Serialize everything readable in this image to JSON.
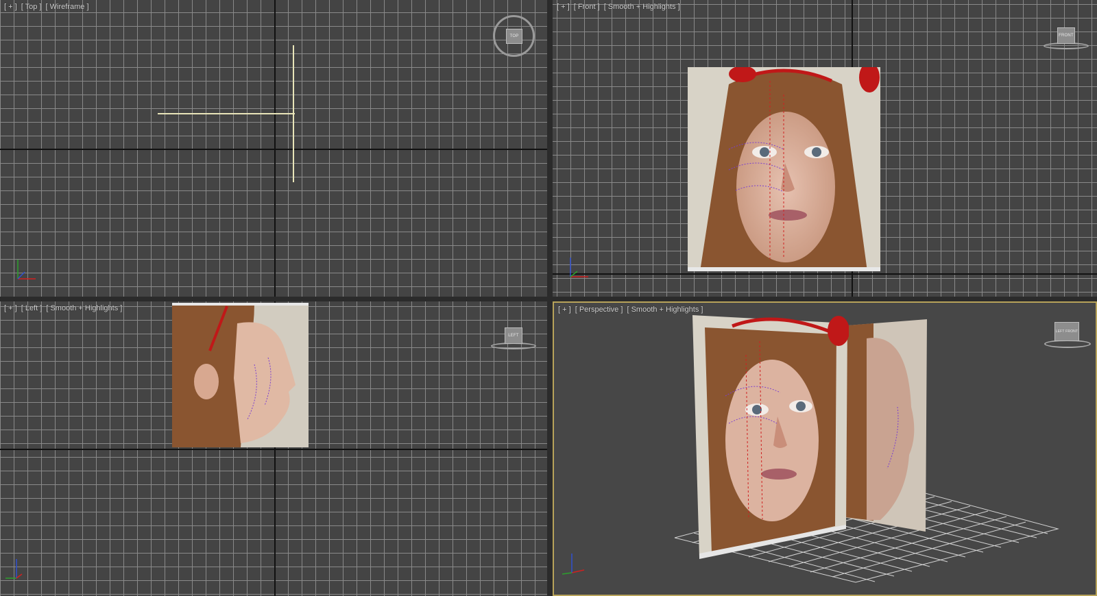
{
  "viewports": {
    "top": {
      "label_plus": "[ + ]",
      "label_view": "[ Top ]",
      "label_shade": "[ Wireframe ]",
      "viewcube_text": "TOP"
    },
    "front": {
      "label_plus": "[ + ]",
      "label_view": "[ Front ]",
      "label_shade": "[ Smooth + Highlights ]",
      "viewcube_text": "FRONT"
    },
    "left": {
      "label_plus": "[ + ]",
      "label_view": "[ Left ]",
      "label_shade": "[ Smooth + Highlights ]",
      "viewcube_text": "LEFT"
    },
    "perspective": {
      "label_plus": "[ + ]",
      "label_view": "[ Perspective ]",
      "label_shade": "[ Smooth + Highlights ]",
      "viewcube_text": "LEFT FRONT"
    }
  },
  "colors": {
    "viewport_bg": "#444444",
    "grid_line": "#8a8a8a",
    "active_border": "#b8a35a",
    "axis_x": "#d12020",
    "axis_y": "#2ca02c",
    "axis_z": "#3050d0"
  },
  "icons": {
    "axis_tripod": "axis-tripod-icon",
    "viewcube": "viewcube-icon"
  }
}
